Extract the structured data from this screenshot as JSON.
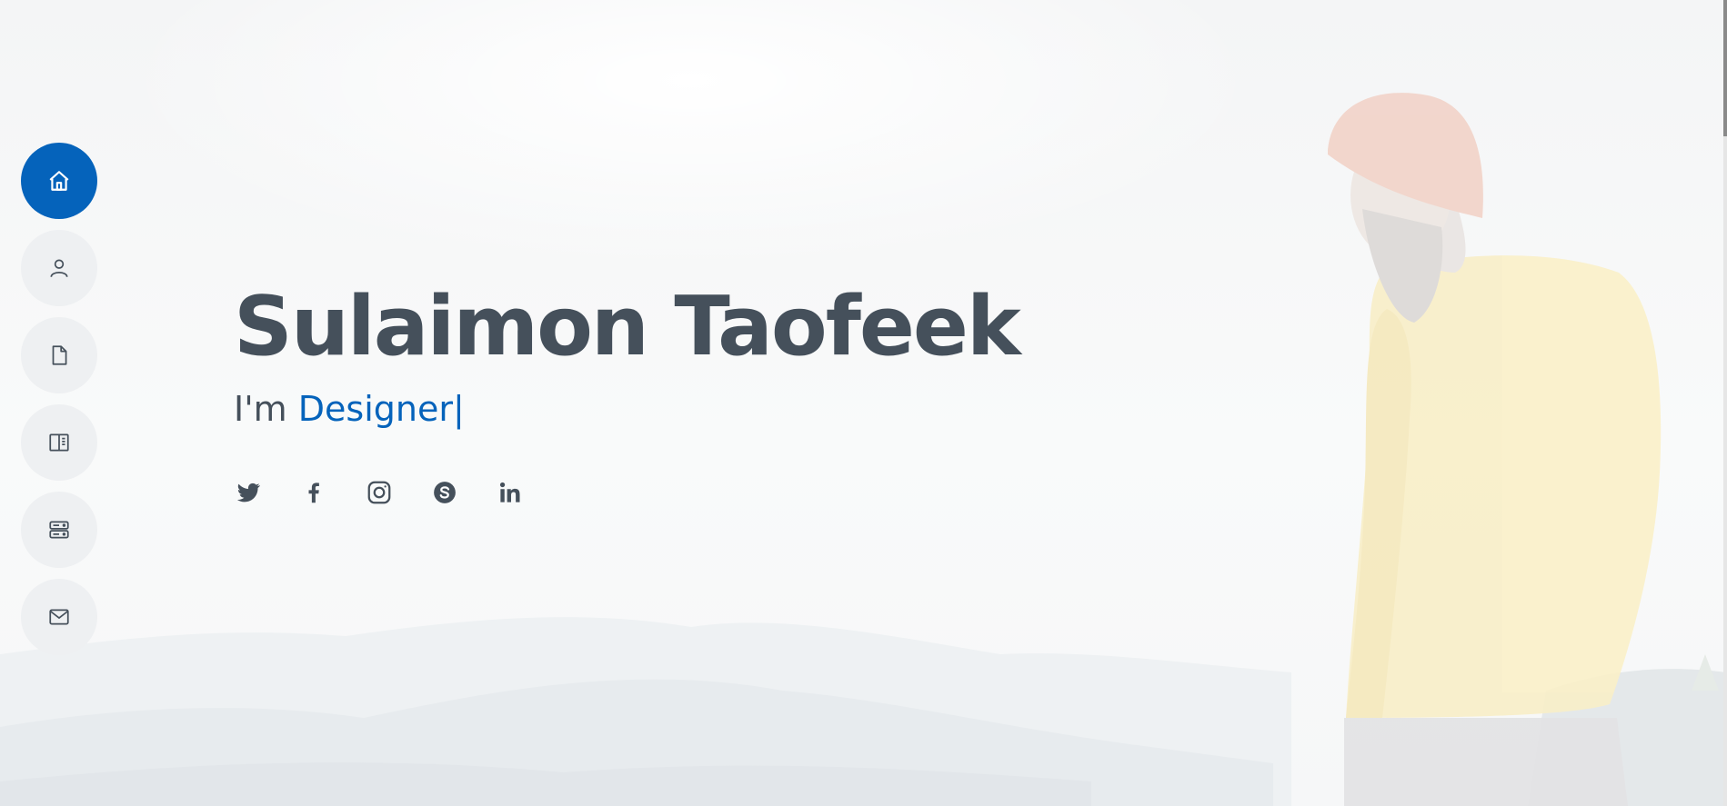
{
  "hero": {
    "name": "Sulaimon Taofeek",
    "prefix": "I'm ",
    "typed": "Designer",
    "cursor": "|"
  },
  "nav": {
    "items": [
      {
        "icon": "home-icon",
        "active": true
      },
      {
        "icon": "person-icon",
        "active": false
      },
      {
        "icon": "file-icon",
        "active": false
      },
      {
        "icon": "book-half-icon",
        "active": false
      },
      {
        "icon": "server-icon",
        "active": false
      },
      {
        "icon": "envelope-icon",
        "active": false
      }
    ]
  },
  "socials": [
    "twitter-icon",
    "facebook-icon",
    "instagram-icon",
    "skype-icon",
    "linkedin-icon"
  ],
  "colors": {
    "accent": "#0563bb",
    "text": "#45505b",
    "nav_bg": "#eef0f2"
  }
}
